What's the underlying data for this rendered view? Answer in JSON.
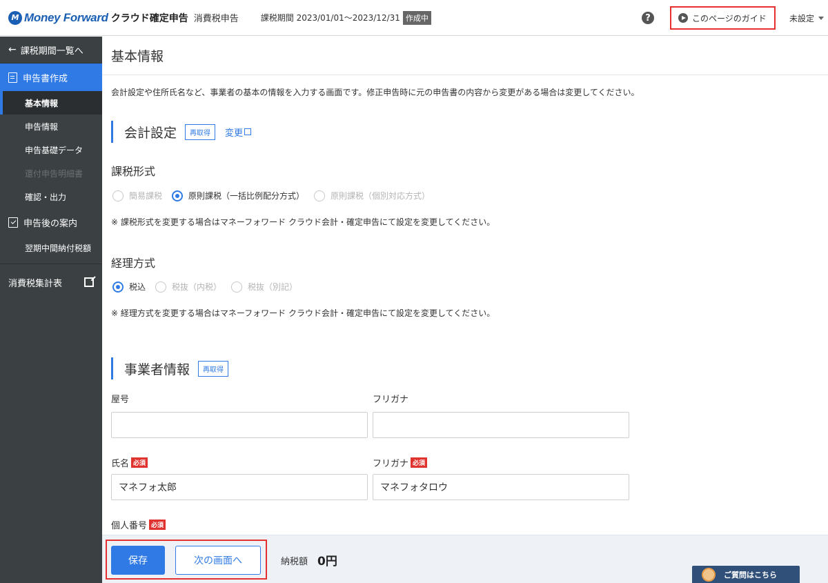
{
  "header": {
    "logo_text": "Money Forward",
    "product_name": "クラウド確定申告",
    "product_sub": "消費税申告",
    "period": "課税期間 2023/01/01〜2023/12/31",
    "status": "作成中",
    "guide_label": "このページのガイド",
    "user_label": "未設定"
  },
  "sidebar": {
    "back_label": "課税期間一覧へ",
    "section_create": "申告書作成",
    "items": [
      {
        "label": "基本情報"
      },
      {
        "label": "申告情報"
      },
      {
        "label": "申告基礎データ"
      },
      {
        "label": "還付申告明細書"
      },
      {
        "label": "確認・出力"
      }
    ],
    "section_after": "申告後の案内",
    "after_items": [
      {
        "label": "翌期中間納付税額"
      }
    ],
    "external_label": "消費税集計表"
  },
  "main": {
    "title": "基本情報",
    "description": "会計設定や住所氏名など、事業者の基本の情報を入力する画面です。修正申告時に元の申告書の内容から変更がある場合は変更してください。",
    "accounting": {
      "title": "会計設定",
      "refetch_label": "再取得",
      "change_label": "変更"
    },
    "taxation": {
      "title": "課税形式",
      "options": [
        "簡易課税",
        "原則課税（一括比例配分方式）",
        "原則課税（個別対応方式）"
      ],
      "note": "※ 課税形式を変更する場合はマネーフォワード クラウド会計・確定申告にて設定を変更してください。"
    },
    "bookkeeping": {
      "title": "経理方式",
      "options": [
        "税込",
        "税抜（内税）",
        "税抜（別記）"
      ],
      "note": "※ 経理方式を変更する場合はマネーフォワード クラウド会計・確定申告にて設定を変更してください。"
    },
    "business": {
      "title": "事業者情報",
      "refetch_label": "再取得",
      "trade_name_label": "屋号",
      "trade_name_value": "",
      "trade_kana_label": "フリガナ",
      "trade_kana_value": "",
      "name_label": "氏名",
      "name_value": "マネフォ太郎",
      "name_kana_label": "フリガナ",
      "name_kana_value": "マネフォタロウ",
      "mynumber_label": "個人番号",
      "required_label": "必須"
    }
  },
  "footer": {
    "save_label": "保存",
    "next_label": "次の画面へ",
    "tax_label": "納税額",
    "tax_value": "0円",
    "support_label": "ご質問はこちら"
  },
  "colors": {
    "accent": "#2f7ae5",
    "sidebar_bg": "#3b4043",
    "highlight": "#e53030",
    "required": "#e0332f"
  }
}
